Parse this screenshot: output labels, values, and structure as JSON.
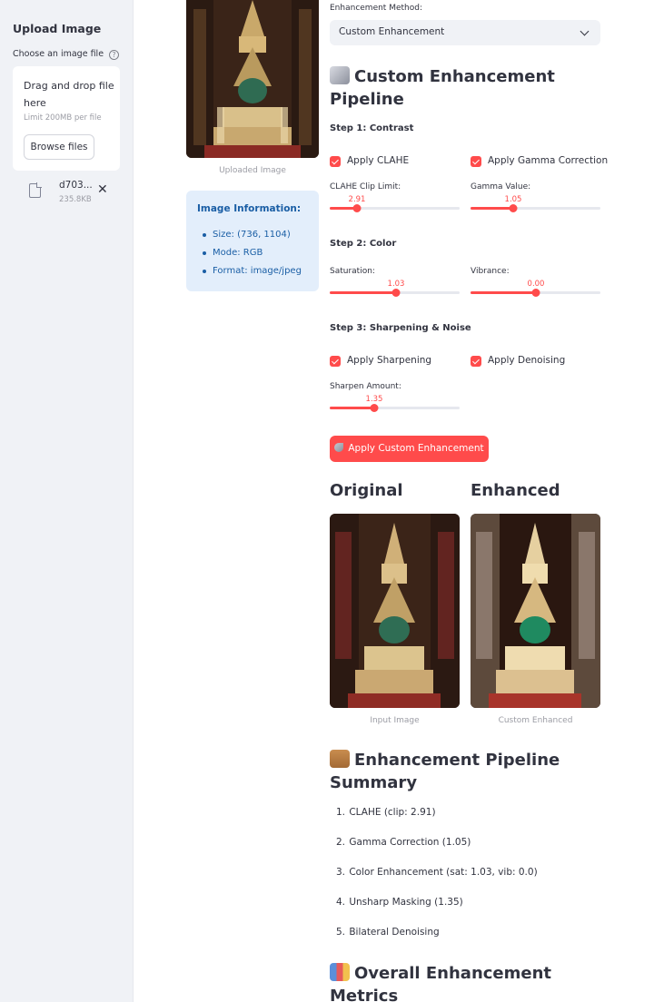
{
  "sidebar": {
    "title": "Upload Image",
    "file_label": "Choose an image file",
    "help_icon": "question-icon",
    "dropzone_text": "Drag and drop file here",
    "dropzone_limit": "Limit 200MB per file",
    "browse_label": "Browse files",
    "file_name": "d703...",
    "file_size": "235.8KB",
    "file_icon": "file-icon",
    "remove_icon": "close-icon"
  },
  "uploaded": {
    "caption": "Uploaded Image"
  },
  "info": {
    "title": "Image Information:",
    "items": [
      "Size: (736, 1104)",
      "Mode: RGB",
      "Format: image/jpeg"
    ]
  },
  "method": {
    "label": "Enhancement Method:",
    "value": "Custom Enhancement"
  },
  "pipeline": {
    "title_emoji": "control-knobs-emoji",
    "title": "Custom Enhancement Pipeline",
    "step1": "Step 1: Contrast",
    "apply_clahe": "Apply CLAHE",
    "apply_gamma": "Apply Gamma Correction",
    "clahe_label": "CLAHE Clip Limit:",
    "clahe_value": "2.91",
    "clahe_fraction": 0.21,
    "gamma_label": "Gamma Value:",
    "gamma_value": "1.05",
    "gamma_fraction": 0.33,
    "step2": "Step 2: Color",
    "saturation_label": "Saturation:",
    "saturation_value": "1.03",
    "saturation_fraction": 0.51,
    "vibrance_label": "Vibrance:",
    "vibrance_value": "0.00",
    "vibrance_fraction": 0.5,
    "step3": "Step 3: Sharpening & Noise",
    "apply_sharpening": "Apply Sharpening",
    "apply_denoising": "Apply Denoising",
    "sharpen_label": "Sharpen Amount:",
    "sharpen_value": "1.35",
    "sharpen_fraction": 0.34,
    "apply_button": "Apply Custom Enhancement",
    "apply_icon": "rocket-icon"
  },
  "comparison": {
    "original_title": "Original",
    "enhanced_title": "Enhanced",
    "original_caption": "Input Image",
    "enhanced_caption": "Custom Enhanced"
  },
  "summary": {
    "title_emoji": "clipboard-emoji",
    "title": "Enhancement Pipeline Summary",
    "items": [
      {
        "num": "1.",
        "text": "CLAHE (clip: 2.91)"
      },
      {
        "num": "2.",
        "text": "Gamma Correction (1.05)"
      },
      {
        "num": "3.",
        "text": "Color Enhancement (sat: 1.03, vib: 0.0)"
      },
      {
        "num": "4.",
        "text": "Unsharp Masking (1.35)"
      },
      {
        "num": "5.",
        "text": "Bilateral Denoising"
      }
    ]
  },
  "metrics": {
    "title_emoji": "bar-chart-emoji",
    "title": "Overall Enhancement Metrics"
  },
  "colors": {
    "accent": "#ff4b4b",
    "sidebar_bg": "#f0f2f6",
    "info_bg": "#e3eefb",
    "info_text": "#1a5ea5"
  }
}
